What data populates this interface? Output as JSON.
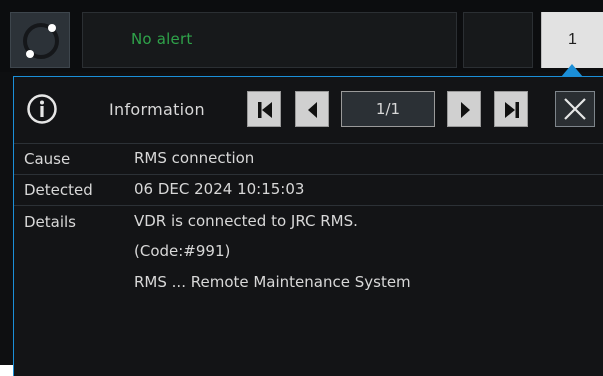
{
  "alert_bar": {
    "status_icon": "ring-status-icon",
    "alert_text": "No alert",
    "alert_count": "1",
    "alert_text_color": "#2fa24a",
    "accent_color": "#1b8fd8"
  },
  "panel": {
    "title": "Information",
    "pager": "1/1",
    "icons": [
      "info-icon",
      "first-page-icon",
      "prev-page-icon",
      "next-page-icon",
      "last-page-icon",
      "close-icon"
    ]
  },
  "details": {
    "cause_label": "Cause",
    "cause_value": "RMS connection",
    "detected_label": "Detected",
    "detected_value": "06 DEC 2024 10:15:03",
    "details_label": "Details",
    "details_lines": [
      "VDR is connected to JRC RMS.",
      "(Code:#991)",
      "RMS ... Remote Maintenance System"
    ]
  }
}
